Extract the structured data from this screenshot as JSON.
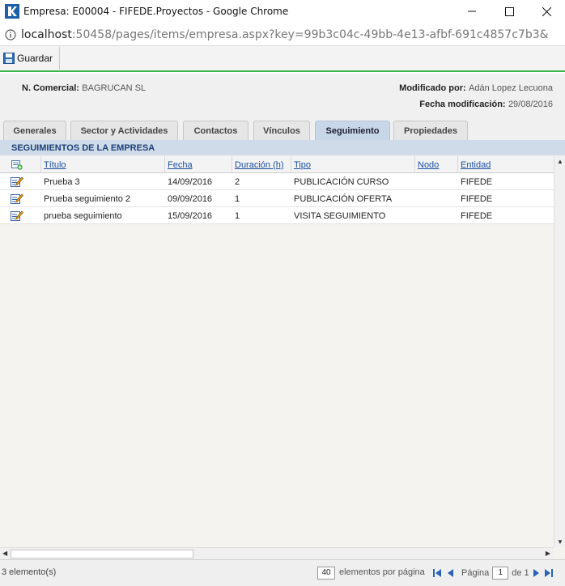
{
  "window": {
    "title": "Empresa: E00004 - FIFEDE.Proyectos - Google Chrome",
    "url_host": "localhost",
    "url_path": ":50458/pages/items/empresa.aspx?key=99b3c04c-49bb-4e13-afbf-691c4857c7b3&"
  },
  "toolbar": {
    "save_label": "Guardar"
  },
  "header": {
    "comercial_label": "N. Comercial:",
    "comercial_value": "BAGRUCAN SL",
    "modificado_label": "Modificado por:",
    "modificado_value": "Adán Lopez Lecuona",
    "fecha_label": "Fecha modificación:",
    "fecha_value": "29/08/2016"
  },
  "tabs": [
    {
      "label": "Generales"
    },
    {
      "label": "Sector y Actividades"
    },
    {
      "label": "Contactos"
    },
    {
      "label": "Vínculos"
    },
    {
      "label": "Seguimiento"
    },
    {
      "label": "Propiedades"
    }
  ],
  "active_tab": "Seguimiento",
  "grid": {
    "section_title": "SEGUIMIENTOS DE LA EMPRESA",
    "columns": [
      "Título",
      "Fecha",
      "Duración (h)",
      "Tipo",
      "Nodo",
      "Entidad"
    ],
    "rows": [
      {
        "titulo": "Prueba 3",
        "fecha": "14/09/2016",
        "duracion": "2",
        "tipo": "PUBLICACIÓN CURSO",
        "nodo": "",
        "entidad": "FIFEDE"
      },
      {
        "titulo": "Prueba seguimiento 2",
        "fecha": "09/09/2016",
        "duracion": "1",
        "tipo": "PUBLICACIÓN OFERTA",
        "nodo": "",
        "entidad": "FIFEDE"
      },
      {
        "titulo": "prueba seguimiento",
        "fecha": "15/09/2016",
        "duracion": "1",
        "tipo": "VISITA SEGUIMIENTO",
        "nodo": "",
        "entidad": "FIFEDE"
      }
    ]
  },
  "footer": {
    "count": "3 elemento(s)",
    "per_page": "40",
    "per_page_label": "elementos por página",
    "page_label": "Página",
    "page_value": "1",
    "of_label": "de 1"
  },
  "colors": {
    "accent_green": "#3cb54a",
    "link_blue": "#1a4fa0",
    "section_bg": "#cfdbe8"
  },
  "icons": [
    "chrome-logo",
    "minimize-icon",
    "maximize-icon",
    "close-icon",
    "info-icon",
    "save-icon",
    "add-record-icon",
    "edit-icon",
    "first-page-icon",
    "prev-page-icon",
    "next-page-icon",
    "last-page-icon"
  ]
}
